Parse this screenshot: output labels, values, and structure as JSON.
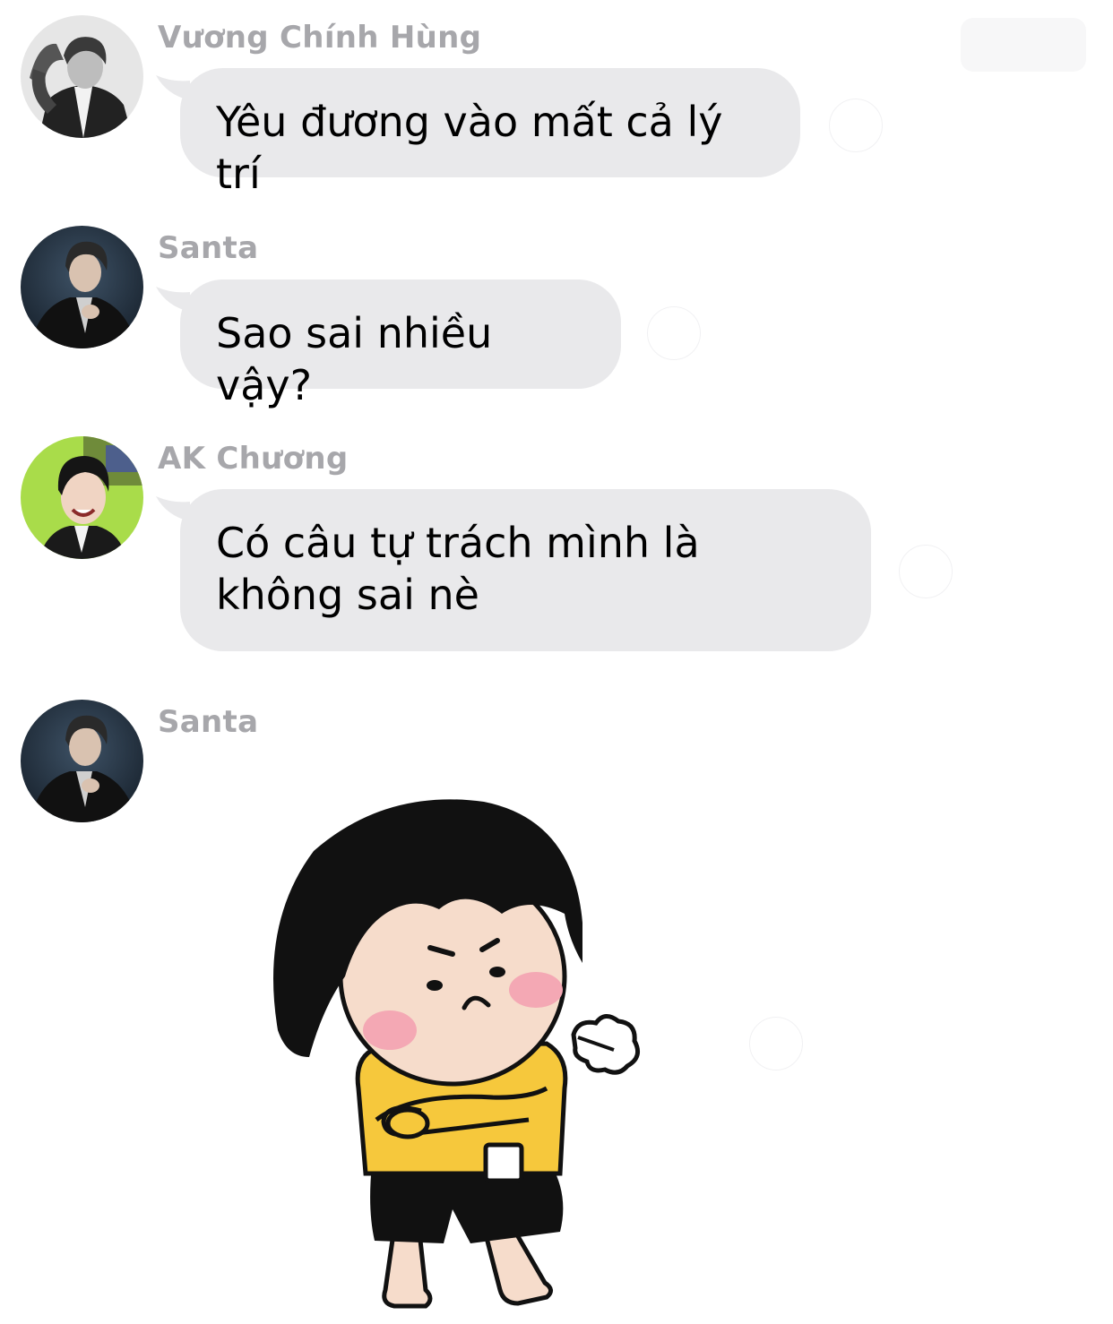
{
  "messages": [
    {
      "sender": "Vương Chính Hùng",
      "text": "Yêu đương vào mất cả lý trí",
      "avatar": "avatar-bw-portrait"
    },
    {
      "sender": "Santa",
      "text": "Sao sai nhiều vậy?",
      "avatar": "avatar-dark-portrait"
    },
    {
      "sender": "AK Chương",
      "text": "Có câu tự trách mình là không sai nè",
      "avatar": "avatar-green-portrait"
    },
    {
      "sender": "Santa",
      "text": "",
      "avatar": "avatar-dark-portrait",
      "attachment": "sticker-angry-girl-arms-crossed"
    }
  ],
  "colors": {
    "bubble": "#e9e9eb",
    "sender_name": "#a7a7ab",
    "background": "#ffffff"
  }
}
